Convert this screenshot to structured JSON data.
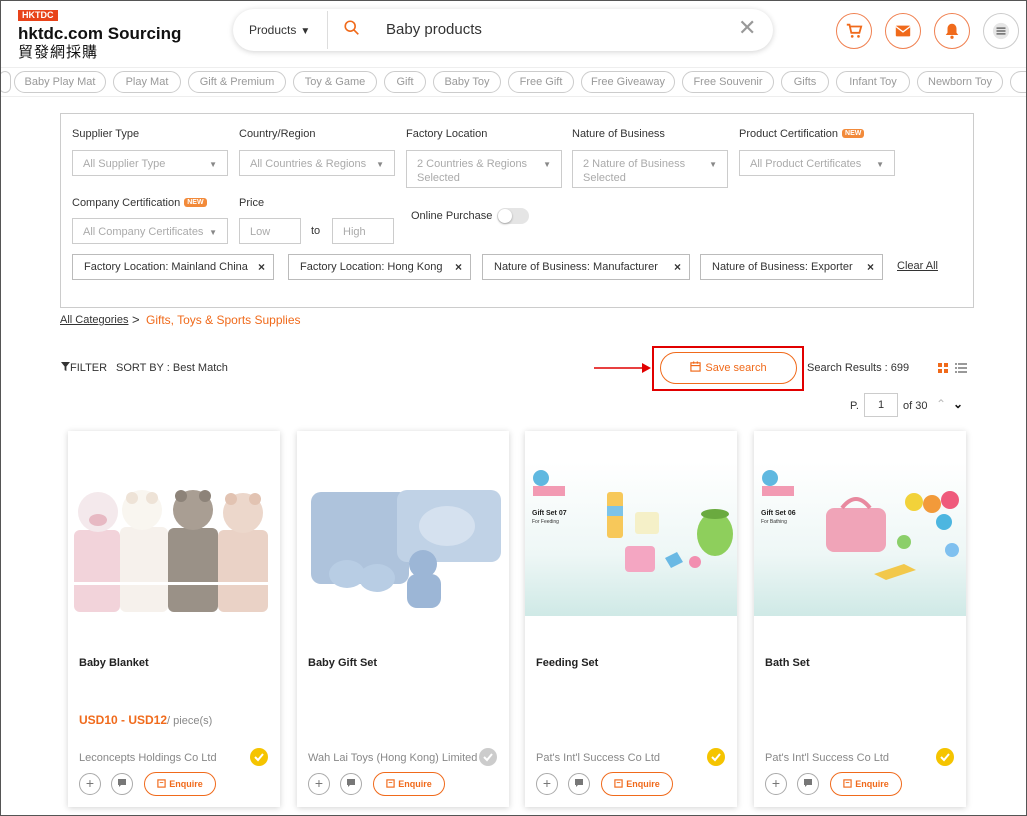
{
  "header": {
    "badge": "HKTDC",
    "title": "hktdc.com Sourcing",
    "title_cn": "貿發網採購",
    "search_category": "Products",
    "search_query": "Baby products"
  },
  "tags": [
    "Baby Play Mat",
    "Play Mat",
    "Gift & Premium",
    "Toy & Game",
    "Gift",
    "Baby Toy",
    "Free Gift",
    "Free Giveaway",
    "Free Souvenir",
    "Gifts",
    "Infant Toy",
    "Newborn Toy"
  ],
  "filters": {
    "supplier_type": {
      "label": "Supplier Type",
      "value": "All Supplier Type"
    },
    "country": {
      "label": "Country/Region",
      "value": "All Countries & Regions"
    },
    "factory": {
      "label": "Factory Location",
      "value_line1": "2 Countries & Regions",
      "value_line2": "Selected"
    },
    "nature": {
      "label": "Nature of Business",
      "value_line1": "2 Nature of Business",
      "value_line2": "Selected"
    },
    "product_cert": {
      "label": "Product Certification",
      "badge": "NEW",
      "value": "All Product Certificates"
    },
    "company_cert": {
      "label": "Company Certification",
      "badge": "NEW",
      "value": "All Company Certificates"
    },
    "price": {
      "label": "Price",
      "low": "Low",
      "to": "to",
      "high": "High"
    },
    "online_purchase": {
      "label": "Online Purchase",
      "enabled": false
    },
    "chips": [
      "Factory Location: Mainland China",
      "Factory Location: Hong Kong",
      "Nature of Business: Manufacturer",
      "Nature of Business: Exporter"
    ],
    "chip_close": "×",
    "clear_all": "Clear All"
  },
  "breadcrumb": {
    "all": "All Categories",
    "sep": ">",
    "current": "Gifts, Toys & Sports Supplies"
  },
  "toolbar": {
    "filter": "FILTER",
    "sort": "SORT BY : Best Match",
    "save_search": "Save search",
    "results": "Search Results : 699"
  },
  "pager": {
    "p": "P.",
    "page": "1",
    "of": "of 30",
    "up": "⌃",
    "down": "⌄"
  },
  "products": [
    {
      "title": "Baby Blanket",
      "price": "USD10 - USD12",
      "unit": "/ piece(s)",
      "supplier": "Leconcepts Holdings Co Ltd",
      "verified": true,
      "enquire": "Enquire"
    },
    {
      "title": "Baby Gift Set",
      "price": "",
      "unit": "",
      "supplier": "Wah Lai Toys (Hong Kong) Limited",
      "verified": false,
      "enquire": "Enquire"
    },
    {
      "title": "Feeding Set",
      "price": "",
      "unit": "",
      "supplier": "Pat's Int'l Success Co Ltd",
      "verified": true,
      "enquire": "Enquire"
    },
    {
      "title": "Bath Set",
      "price": "",
      "unit": "",
      "supplier": "Pat's Int'l Success Co Ltd",
      "verified": true,
      "enquire": "Enquire"
    }
  ],
  "product_images": [
    {
      "gift_set": "",
      "for": ""
    },
    {
      "gift_set": "",
      "for": ""
    },
    {
      "gift_set": "Gift Set 07",
      "for": "For Feeding"
    },
    {
      "gift_set": "Gift Set 06",
      "for": "For Bathing"
    }
  ],
  "colors": {
    "accent": "#f06a1b",
    "highlight": "#e10000",
    "verified": "#f5c400"
  }
}
